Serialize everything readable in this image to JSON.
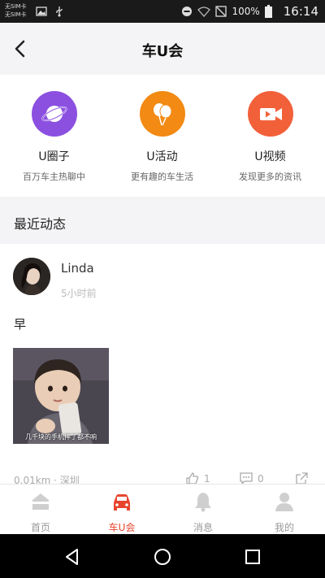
{
  "status_bar": {
    "sim_line1": "无SIM卡",
    "sim_line2": "无SIM卡",
    "battery_pct": "100%",
    "time": "16:14",
    "icons": [
      "image-icon",
      "usb-icon",
      "dnd-icon",
      "wifi-icon",
      "no-signal-icon",
      "battery-icon"
    ]
  },
  "header": {
    "title": "车U会",
    "back_icon": "back-icon"
  },
  "features": [
    {
      "title": "U圈子",
      "desc": "百万车主热聊中",
      "icon": "planet-icon",
      "color": "#8b50e0"
    },
    {
      "title": "U活动",
      "desc": "更有趣的车生活",
      "icon": "balloon-icon",
      "color": "#f28a13"
    },
    {
      "title": "U视频",
      "desc": "发现更多的资讯",
      "icon": "video-camera-icon",
      "color": "#f2603a"
    }
  ],
  "section": {
    "title": "最近动态"
  },
  "post": {
    "username": "Linda",
    "time": "5小时前",
    "text": "早",
    "image_caption": "几千块的手机摔了都不响",
    "distance_location": "0.01km · 深圳",
    "likes": "1",
    "comments": "0"
  },
  "tabbar": {
    "tabs": [
      {
        "label": "首页",
        "icon": "home-icon",
        "active": false
      },
      {
        "label": "车U会",
        "icon": "car-icon",
        "active": true
      },
      {
        "label": "消息",
        "icon": "bell-icon",
        "active": false
      },
      {
        "label": "我的",
        "icon": "user-icon",
        "active": false
      }
    ],
    "active_color": "#e8452e",
    "inactive_color": "#999999"
  },
  "navbar": {
    "icons": [
      "nav-back-icon",
      "nav-home-icon",
      "nav-recents-icon"
    ]
  }
}
